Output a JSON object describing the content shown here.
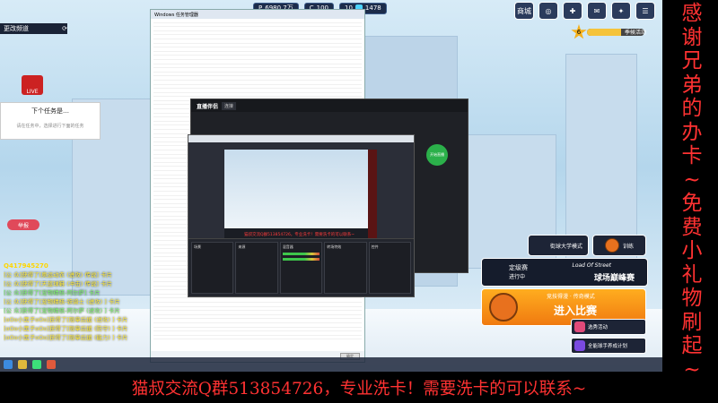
{
  "topbar": {
    "p_label": "P",
    "p_value": "6980.7万",
    "c_label": "C",
    "c_value": "100",
    "level_a": "10",
    "currency": "1478"
  },
  "topicons": [
    {
      "label": "商城",
      "icon": "shop-cart-icon"
    },
    {
      "label": "",
      "icon": "coin-icon"
    },
    {
      "label": "",
      "icon": "gift-icon"
    },
    {
      "label": "",
      "icon": "mail-icon"
    },
    {
      "label": "",
      "icon": "bulb-icon"
    },
    {
      "label": "",
      "icon": "menu-icon"
    }
  ],
  "level": {
    "star": "6",
    "text": "季候活动",
    "progress": 0.6
  },
  "left": {
    "change_channel": "更改频道",
    "live_label": "LIVE",
    "task_title": "下个任务是…",
    "task_sub": "请在任务中，选择进行下面的任务",
    "report_btn": "举报"
  },
  "chat": {
    "user_id": "Q417945270",
    "lines": [
      "[公 众]获得了[奥运动衣 (进攻) 传说] 卡片",
      "[公 众]获得了[天蓝球鞋 (冲击) 传说] 卡片",
      "[公 众]获得了[宠物精核-阿尔萨] 卡片",
      "[公 众]获得了[宠物精核-铁骑士 (进攻) ] 卡片",
      "[公 众]获得了[宠物精核-阿尔萨 (进攻) ] 卡片",
      "[oOo小黑子oOo]获得了[限章后援 (进攻) ] 卡片",
      "[oOo小黑子oOo]获得了[限章后援 (防守) ] 卡片",
      "[oOo小黑子oOo]获得了[限章后援 (能力) ] 卡片"
    ]
  },
  "explorer": {
    "title": "Windows 任务管理器",
    "cancel": "确定"
  },
  "obs": {
    "brand": "直播伴侣",
    "tab": "连接",
    "caption": "猫叔交流Q群513854726，专业洗卡！需要洗卡的可以联系~",
    "start_label": "开始直播"
  },
  "obs_panels": [
    {
      "title": "场景"
    },
    {
      "title": "来源"
    },
    {
      "title": "混音器"
    },
    {
      "title": "转场特效"
    },
    {
      "title": "控件"
    }
  ],
  "right": {
    "dribble": "街球大学模式",
    "training": "训练",
    "ladder_l1": "定级赛",
    "ladder_l2": "进行中",
    "ladder_r1": "Load Of Street",
    "ladder_r2": "球场巅峰赛",
    "enter_sub": "竞技得漫 · 传奇模式",
    "enter_main": "进入比赛",
    "side1": "选秀活动",
    "side2": "全能球手养成计划"
  },
  "banner_right": "感谢兄弟的办卡~免费小礼物刷起~",
  "banner_bottom": "猫叔交流Q群513854726，专业洗卡！需要洗卡的可以联系~",
  "colors": {
    "accent_red": "#ff3232",
    "orange": "#f07a10"
  }
}
